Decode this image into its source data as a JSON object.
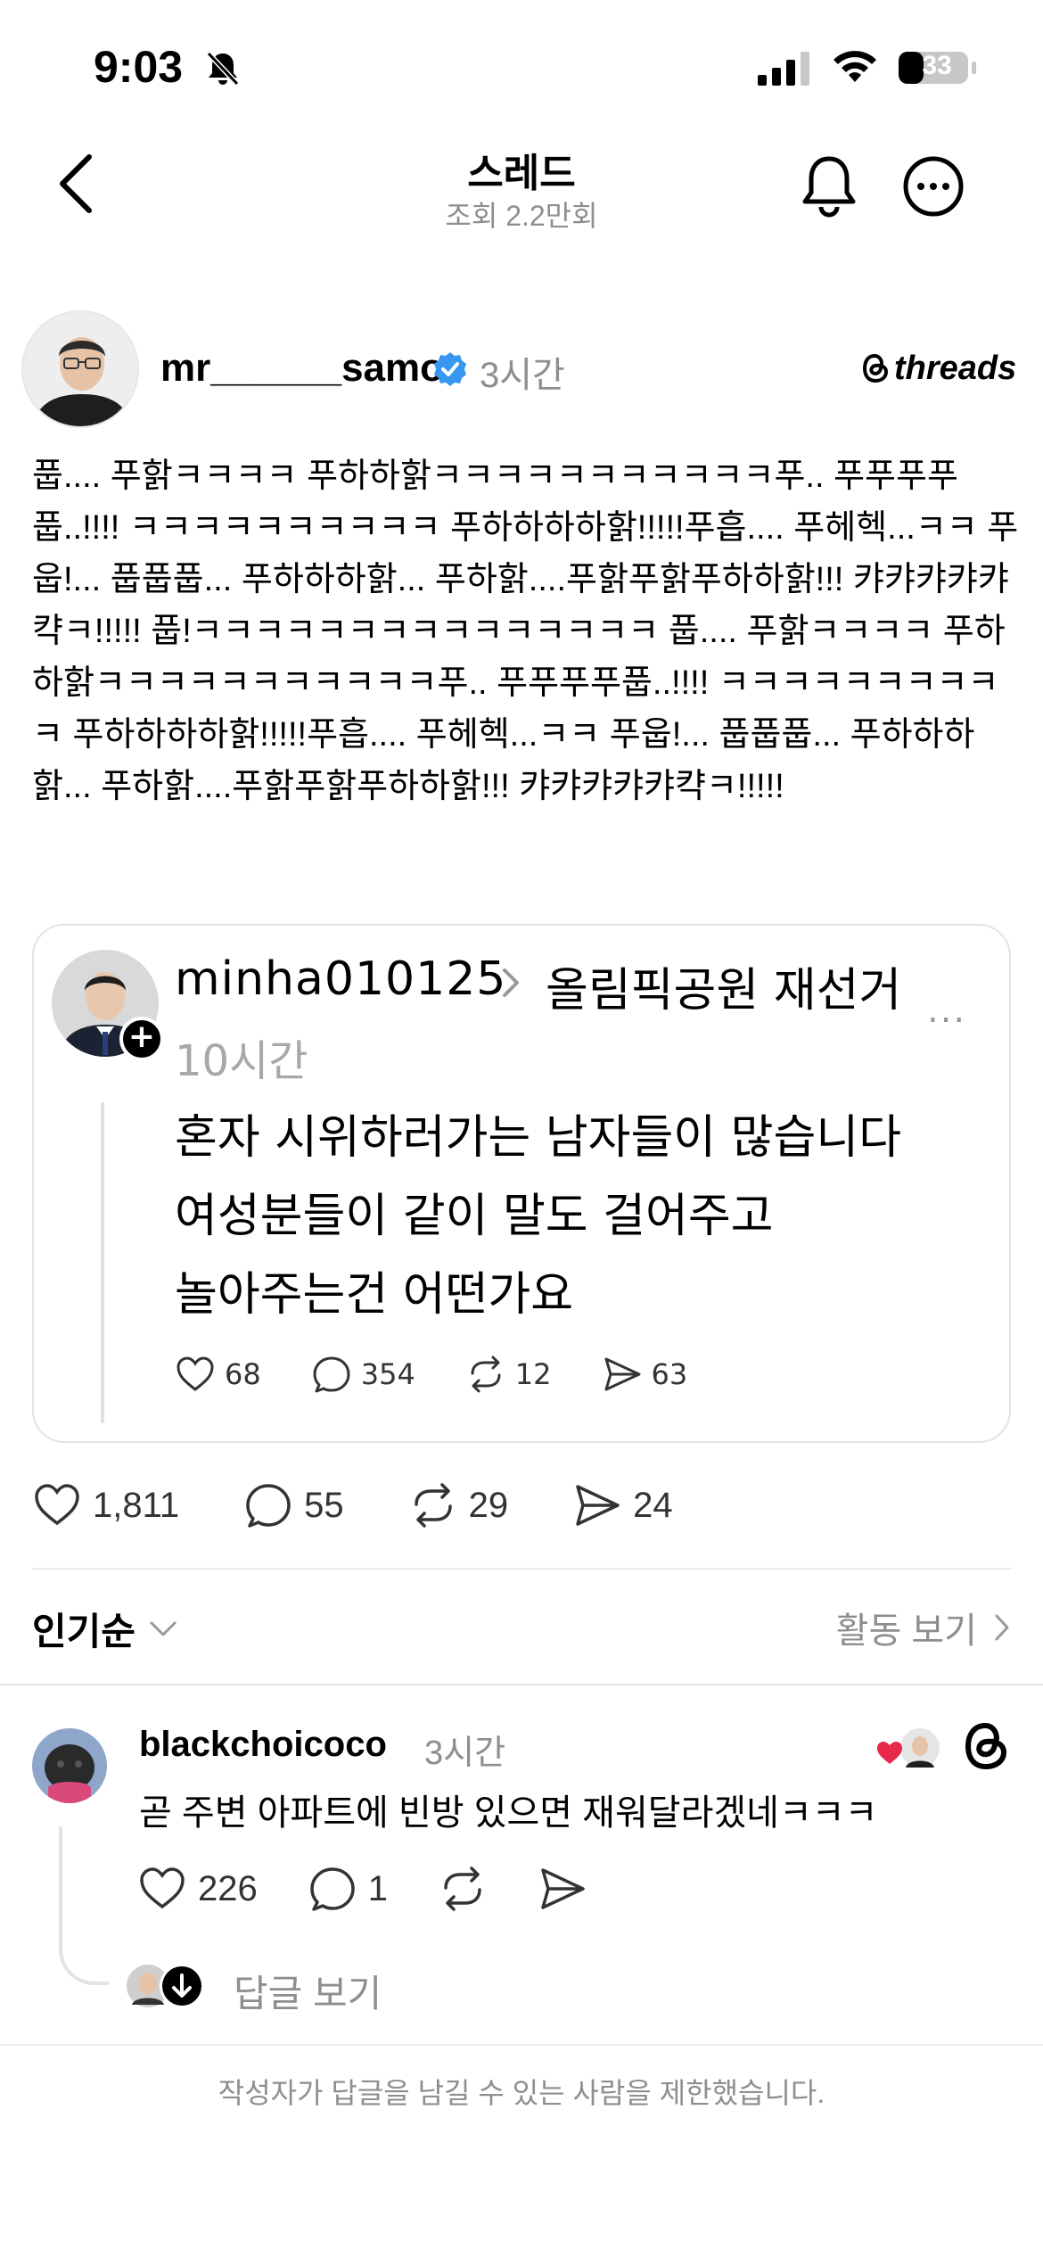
{
  "status_bar": {
    "time": "9:03",
    "battery": "33",
    "icons": [
      "bell-off-icon",
      "signal-icon",
      "wifi-icon",
      "battery-icon"
    ]
  },
  "header": {
    "title": "스레드",
    "subtitle": "조회 2.2만회",
    "icons": [
      "back-icon",
      "notification-bell-icon",
      "more-options-icon"
    ]
  },
  "post": {
    "username": "mr______samo",
    "time": "3시간",
    "brand": "threads",
    "text": "풉.... 푸핡ㅋㅋㅋㅋ 푸하하핡ㅋㅋㅋㅋㅋㅋㅋㅋㅋㅋㅋ푸.. 푸푸푸푸풉..!!!! ㅋㅋㅋㅋㅋㅋㅋㅋㅋㅋ 푸하하하하핡!!!!!푸흡.... 푸헤헥...ㅋㅋ 푸웁!... 풉풉풉... 푸하하하핡... 푸하핡....푸핡푸핡푸하하핡!!! 캬캬캬캬캬캭ㅋ!!!!! 풉!ㅋㅋㅋㅋㅋㅋㅋㅋㅋㅋㅋㅋㅋㅋㅋ 풉.... 푸핡ㅋㅋㅋㅋ 푸하하핡ㅋㅋㅋㅋㅋㅋㅋㅋㅋㅋㅋ푸.. 푸푸푸푸풉..!!!! ㅋㅋㅋㅋㅋㅋㅋㅋㅋㅋ 푸하하하하핡!!!!!푸흡.... 푸헤헥...ㅋㅋ 푸웁!... 풉풉풉... 푸하하하핡... 푸하핡....푸핡푸핡푸하하핡!!! 캬캬캬캬캬캭ㅋ!!!!!",
    "likes": "1,811",
    "comments": "55",
    "reposts": "29",
    "shares": "24"
  },
  "quote": {
    "username": "minha010125",
    "topic": "올림픽공원 재선거",
    "time": "10시간",
    "more": "...",
    "lines": [
      "혼자 시위하러가는 남자들이 많습니다",
      "여성분들이 같이 말도 걸어주고",
      "놀아주는건 어떤가요"
    ],
    "likes": "68",
    "comments": "354",
    "reposts": "12",
    "shares": "63"
  },
  "sort": {
    "label": "인기순",
    "activity": "활동 보기"
  },
  "comment": {
    "username": "blackchoicoco",
    "time": "3시간",
    "text": "곧 주변 아파트에 빈방 있으면 재워달라겠네ㅋㅋㅋ",
    "likes": "226",
    "comments": "1",
    "view_replies": "답글 보기"
  },
  "footer": {
    "note": "작성자가 답글을 남길 수 있는 사람을 제한했습니다."
  },
  "colors": {
    "verified": "#3897f0",
    "secondary_text": "#8e8e8e",
    "like_heart": "#e8294a"
  }
}
